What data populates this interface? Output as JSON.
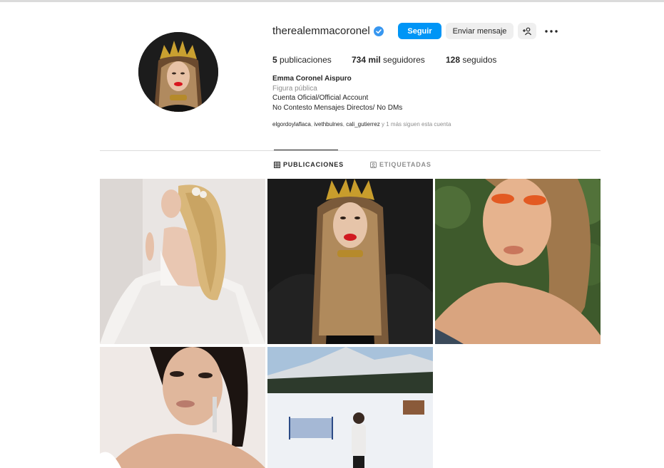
{
  "profile": {
    "username": "therealemmacoronel",
    "follow_label": "Seguir",
    "message_label": "Enviar mensaje",
    "stats": {
      "posts_num": "5",
      "posts_label": "publicaciones",
      "followers_num": "734 mil",
      "followers_label": "seguidores",
      "following_num": "128",
      "following_label": "seguidos"
    },
    "full_name": "Emma Coronel Aispuro",
    "category": "Figura pública",
    "bio_line1": "Cuenta Oficial/Official Account",
    "bio_line2": "No Contesto Mensajes Directos/ No DMs",
    "followed_by": {
      "user1": "elgordoylaflaca",
      "sep1": ", ",
      "user2": "ivethbulnes",
      "sep2": ", ",
      "user3": "cali_gutierrez",
      "rest": " y 1 más siguen esta cuenta"
    }
  },
  "tabs": {
    "publicaciones": "PUBLICACIONES",
    "etiquetadas": "ETIQUETADAS"
  },
  "colors": {
    "accent": "#0095f6",
    "verified": "#3897f0",
    "muted": "#8e8e8e"
  }
}
